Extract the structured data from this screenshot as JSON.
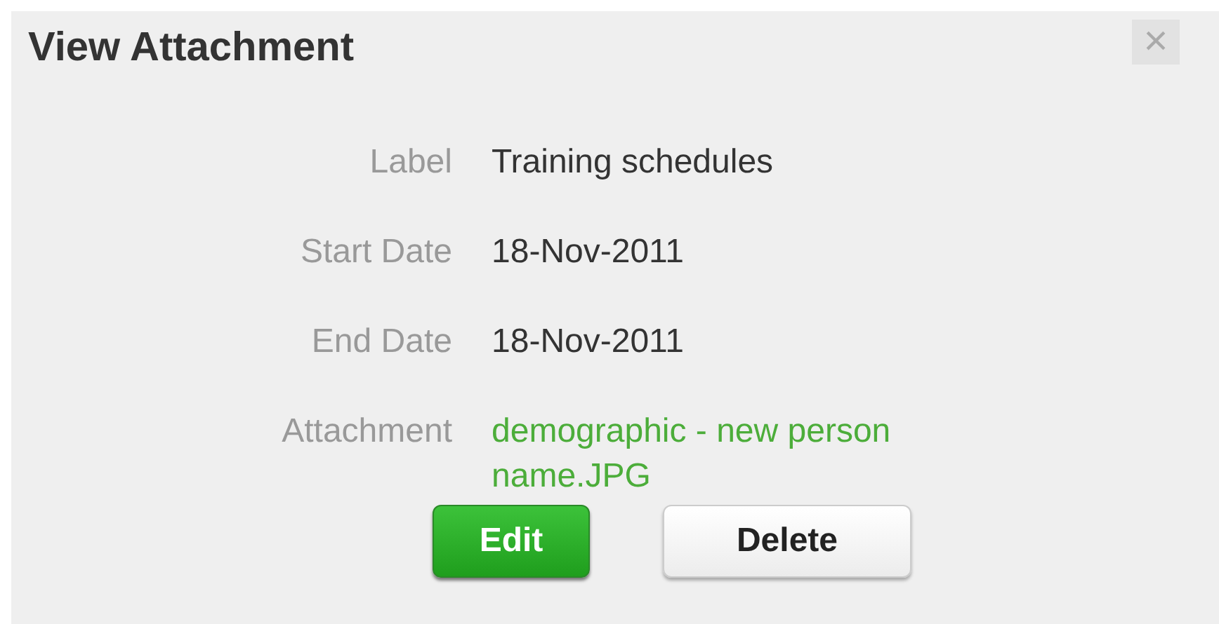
{
  "dialog": {
    "title": "View Attachment",
    "close": "×"
  },
  "fields": [
    {
      "label": "Label",
      "value": "Training schedules",
      "kind": "text"
    },
    {
      "label": "Start Date",
      "value": "18-Nov-2011",
      "kind": "text"
    },
    {
      "label": "End Date",
      "value": "18-Nov-2011",
      "kind": "text"
    },
    {
      "label": "Attachment",
      "value": "demographic - new person name.JPG",
      "kind": "link"
    }
  ],
  "buttons": [
    {
      "label": "Edit",
      "kind": "primary"
    },
    {
      "label": "Delete",
      "kind": "default"
    }
  ]
}
